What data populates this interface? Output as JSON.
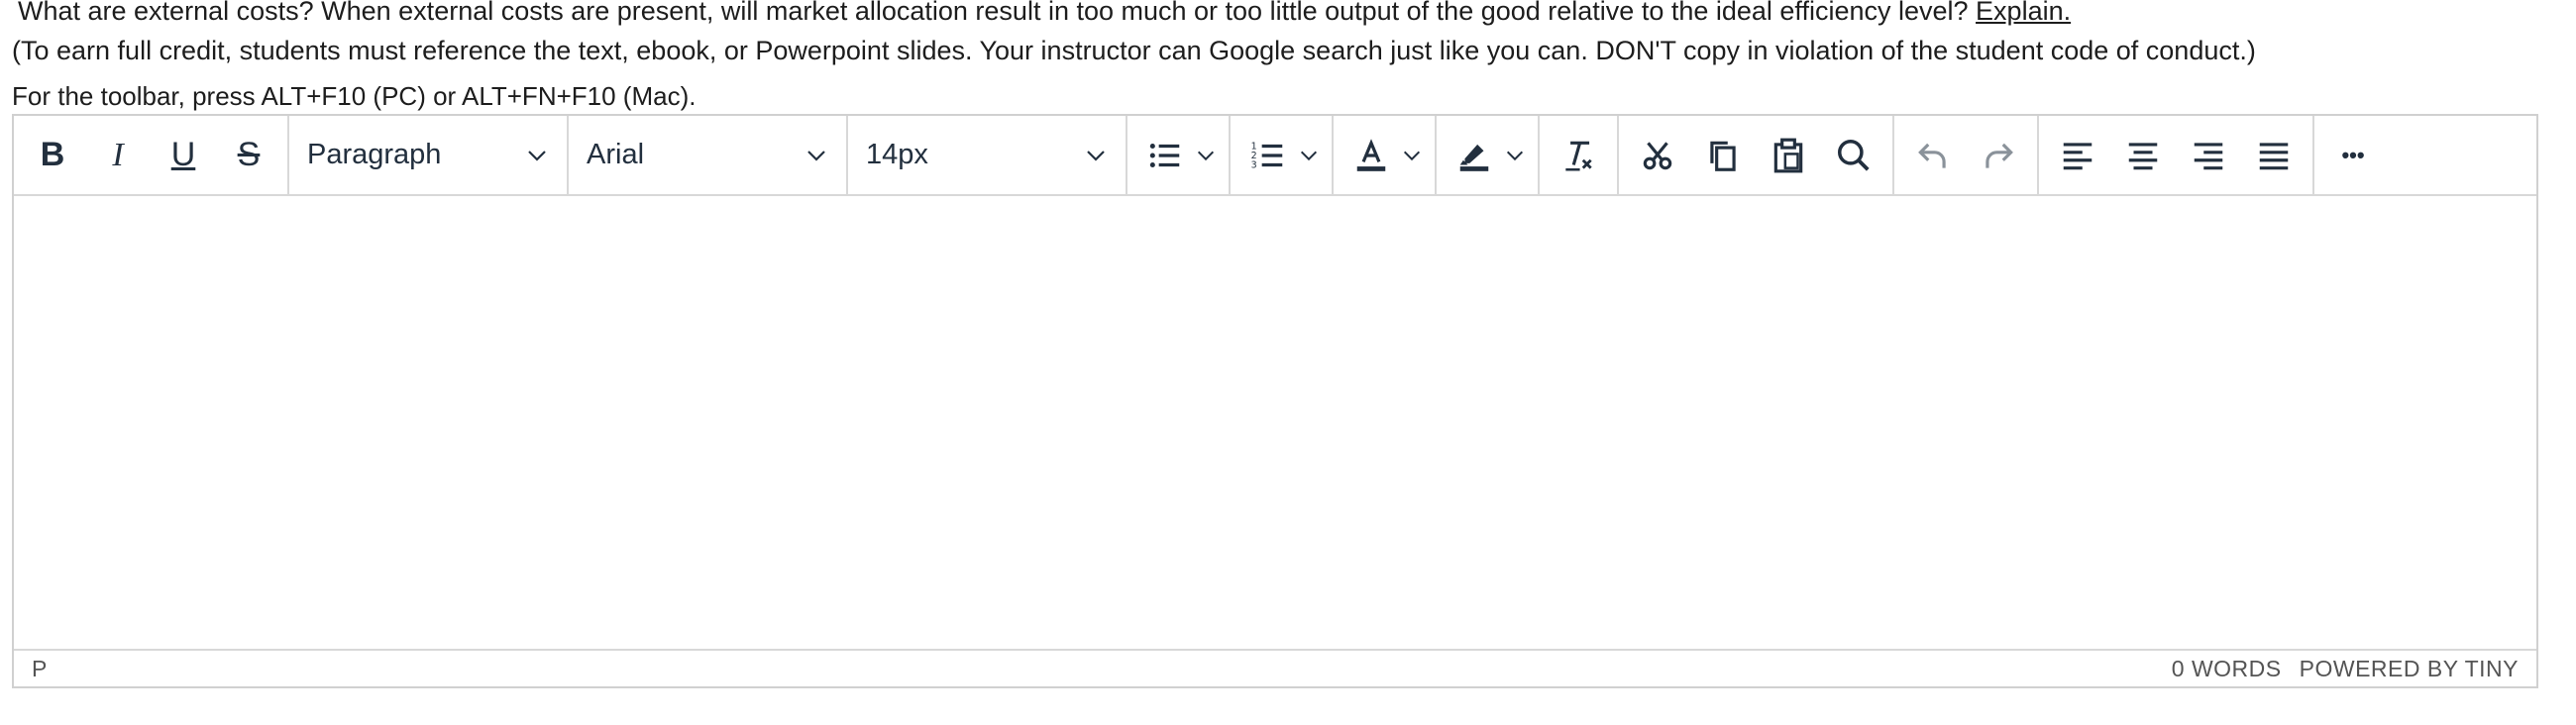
{
  "question": {
    "text": "What are external costs? When external costs are present, will market allocation result in too much or too little output of the good relative to the ideal efficiency level?",
    "link": "Explain."
  },
  "note": "(To earn full credit, students must reference the text, ebook, or Powerpoint slides. Your instructor can Google search just like you can. DON'T copy in violation of the student code of conduct.)",
  "hint": "For the toolbar, press ALT+F10 (PC) or ALT+FN+F10 (Mac).",
  "toolbar": {
    "bold": "B",
    "italic": "I",
    "underline": "U",
    "strikethrough": "S",
    "block_format": "Paragraph",
    "font_family": "Arial",
    "font_size": "14px",
    "more": "•••"
  },
  "editor": {
    "content": ""
  },
  "statusbar": {
    "path": "P",
    "word_count": "0 WORDS",
    "powered_by": "POWERED BY TINY"
  },
  "colors": {
    "icon": "#222f3e",
    "border": "#d0d0d0",
    "disabled_icon": "#8a929a"
  }
}
